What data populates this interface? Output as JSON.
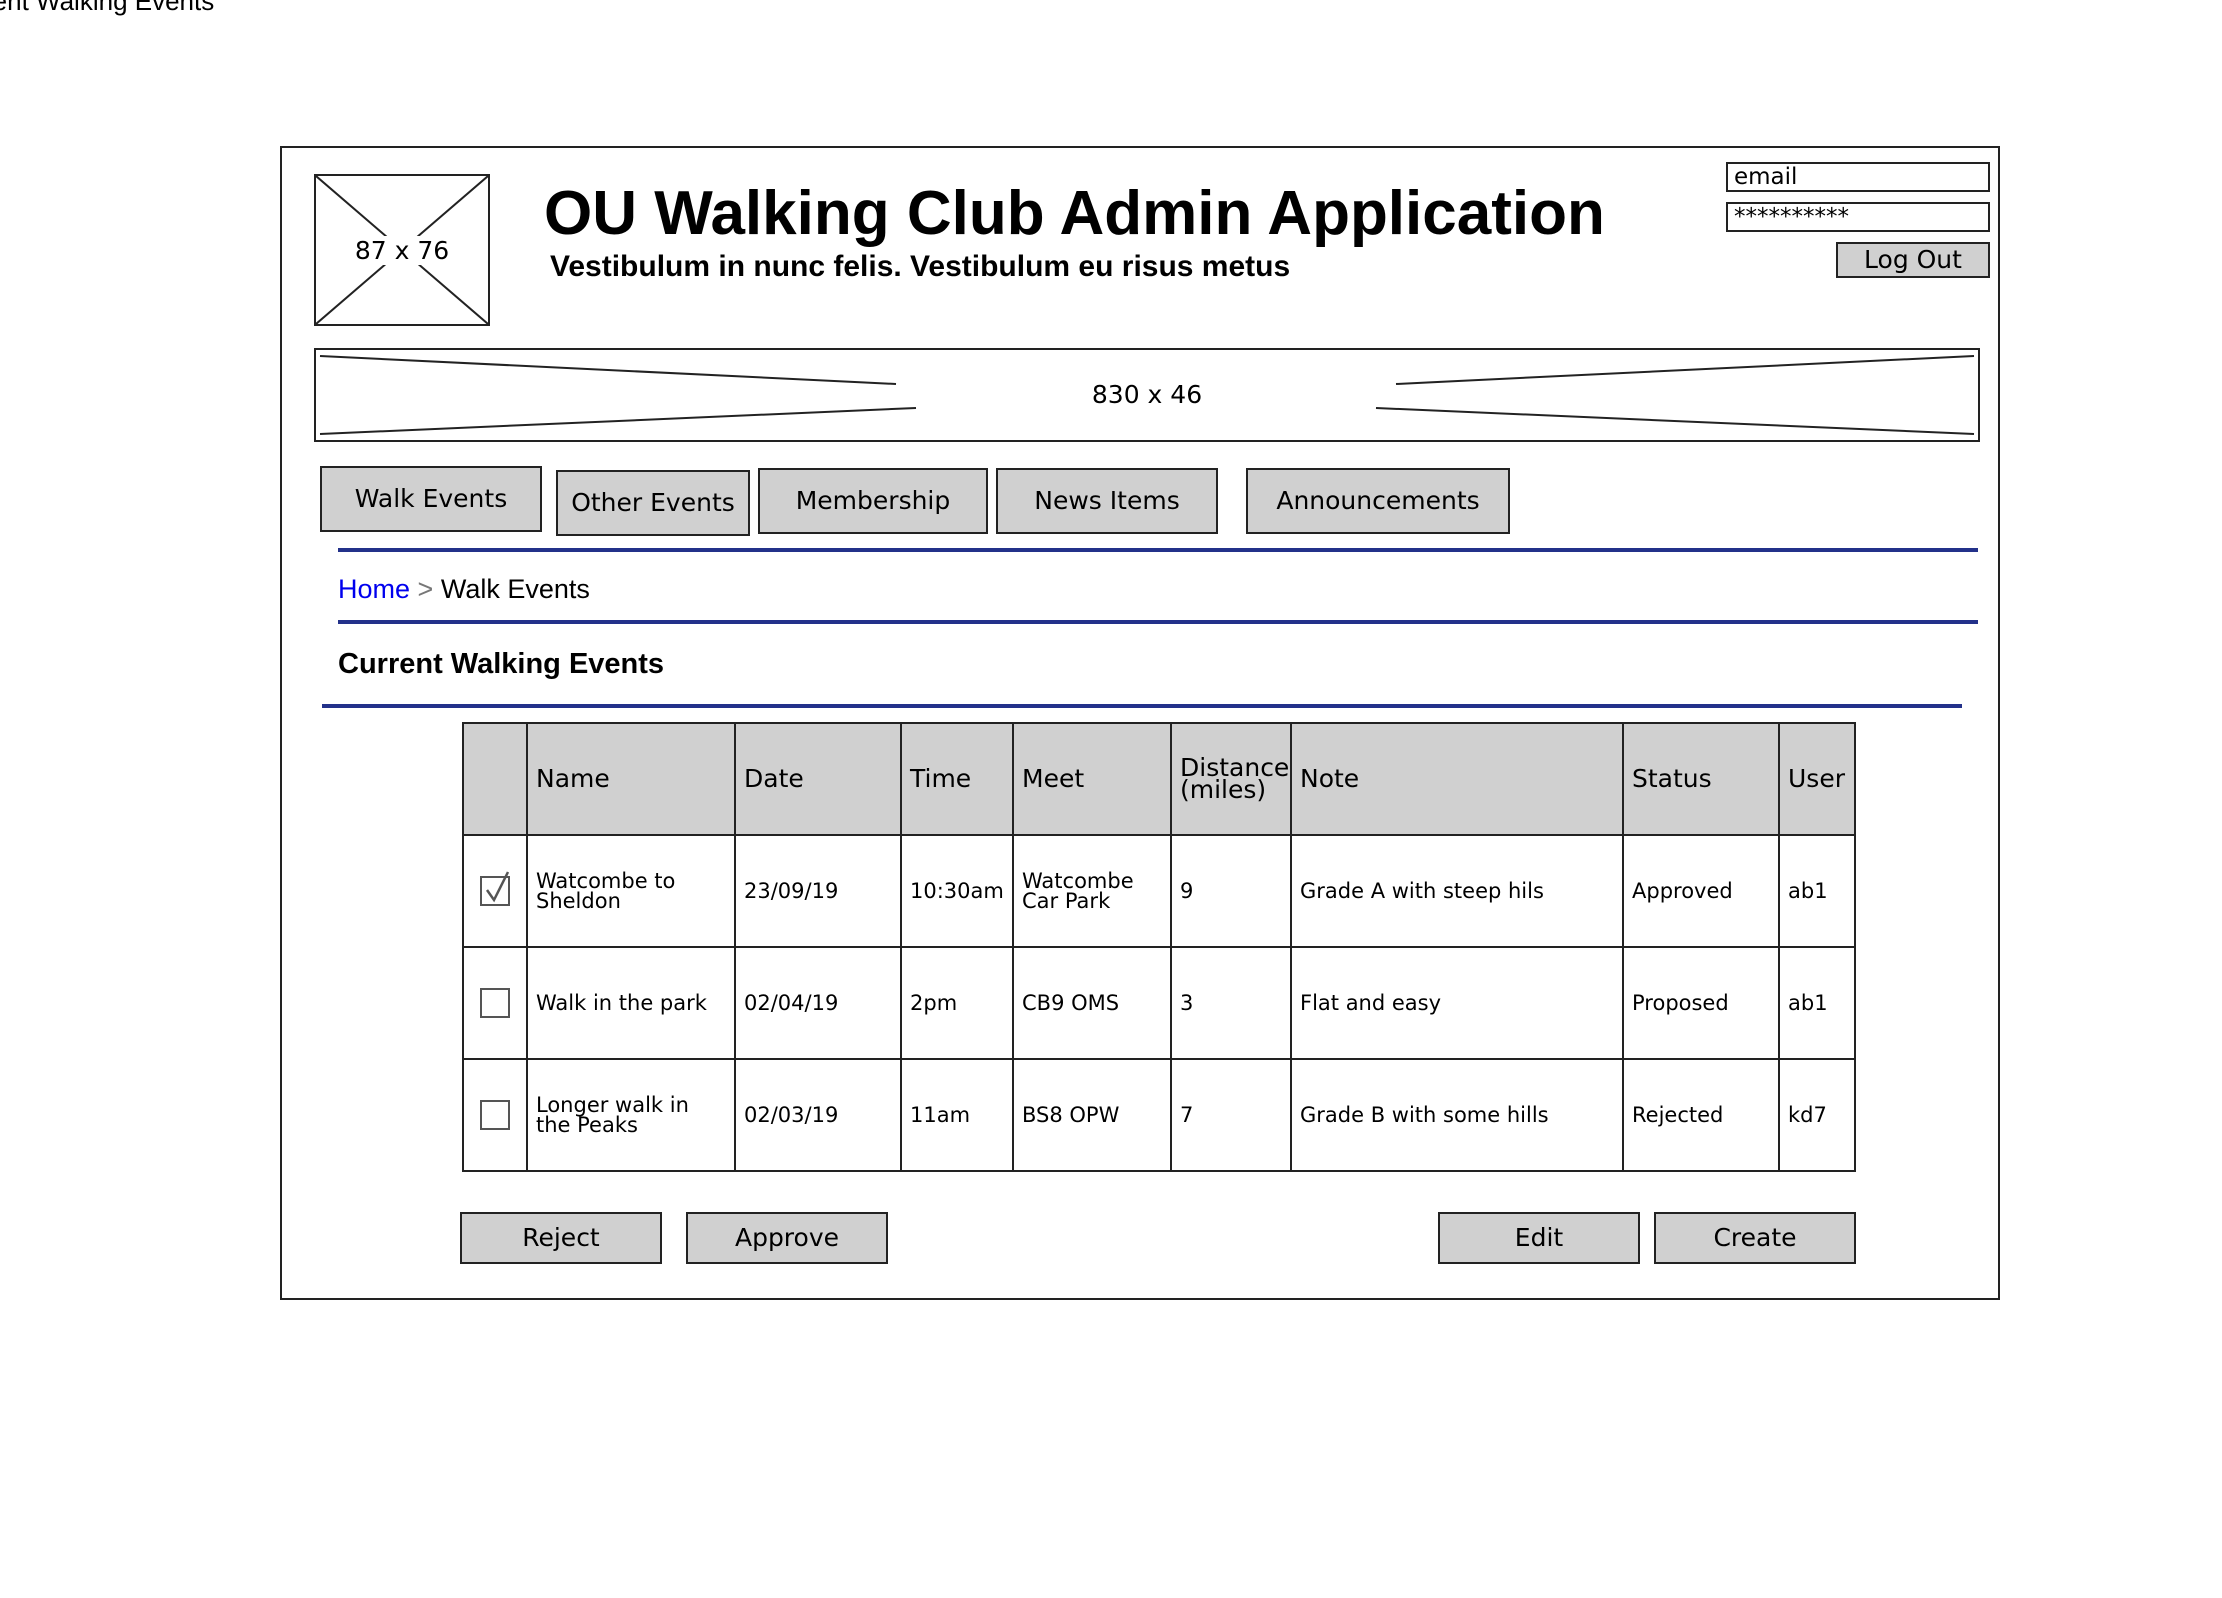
{
  "doc_title": "rent Walking Events",
  "header": {
    "logo_placeholder": "87 x 76",
    "title": "OU Walking Club Admin Application",
    "subtitle": "Vestibulum in nunc felis. Vestibulum eu risus metus",
    "banner_placeholder": "830 x 46"
  },
  "login": {
    "email_value": "email",
    "password_value": "**********",
    "logout_label": "Log Out"
  },
  "tabs": [
    {
      "label": "Walk Events",
      "active": true
    },
    {
      "label": "Other Events"
    },
    {
      "label": "Membership"
    },
    {
      "label": "News Items"
    },
    {
      "label": "Announcements"
    }
  ],
  "breadcrumb": {
    "home": "Home",
    "separator": ">",
    "current": "Walk Events"
  },
  "section_title": "Current Walking Events",
  "table": {
    "columns": [
      "",
      "Name",
      "Date",
      "Time",
      "Meet",
      "Distance (miles)",
      "Note",
      "Status",
      "User"
    ],
    "rows": [
      {
        "checked": true,
        "name": "Watcombe to Sheldon",
        "date": "23/09/19",
        "time": "10:30am",
        "meet": "Watcombe Car Park",
        "distance": "9",
        "note": "Grade A with steep hils",
        "status": "Approved",
        "user": "ab1"
      },
      {
        "checked": false,
        "name": "Walk in the park",
        "date": "02/04/19",
        "time": "2pm",
        "meet": "CB9 OMS",
        "distance": "3",
        "note": "Flat and easy",
        "status": "Proposed",
        "user": "ab1"
      },
      {
        "checked": false,
        "name": "Longer walk in the Peaks",
        "date": "02/03/19",
        "time": "11am",
        "meet": "BS8 OPW",
        "distance": "7",
        "note": "Grade B with some hills",
        "status": "Rejected",
        "user": "kd7"
      }
    ]
  },
  "actions": {
    "reject": "Reject",
    "approve": "Approve",
    "edit": "Edit",
    "create": "Create"
  },
  "colors": {
    "rule": "#23318a",
    "button_fill": "#d0d0d0",
    "link": "#0000ee"
  }
}
